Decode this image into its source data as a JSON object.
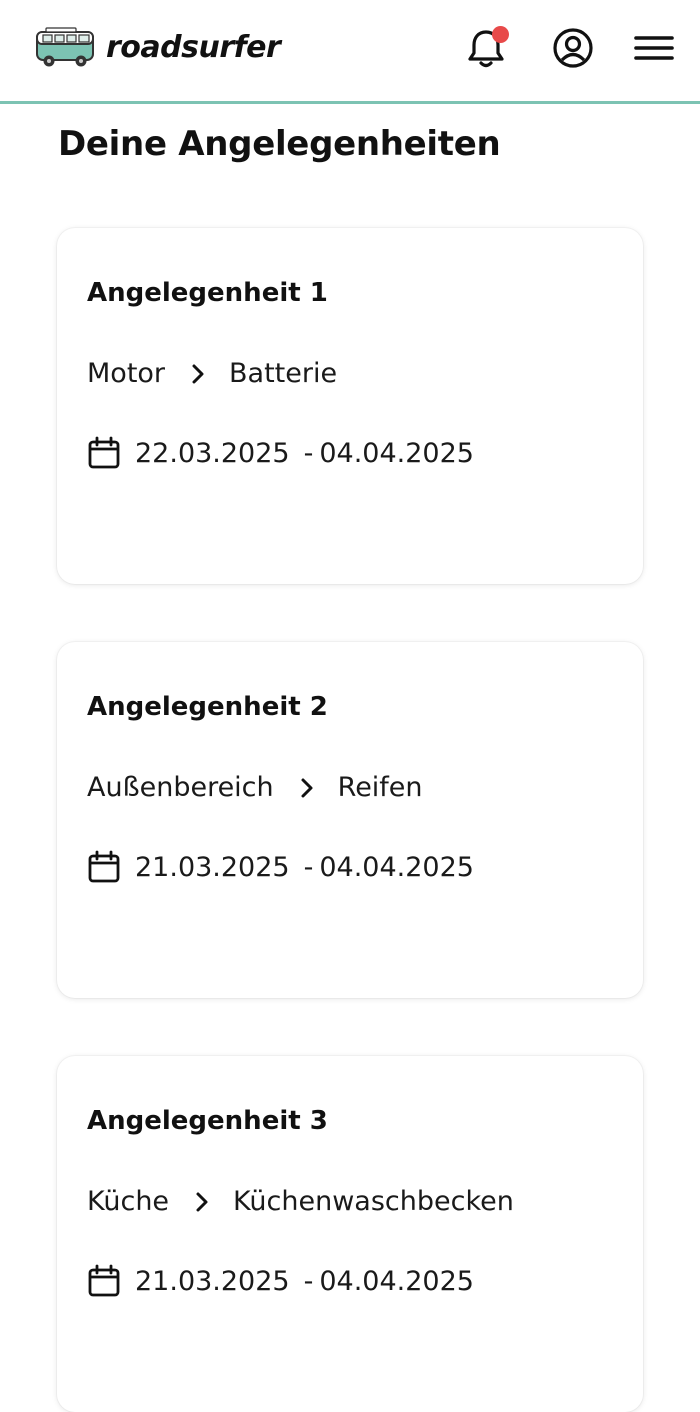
{
  "header": {
    "logo_text": "roadsurfer",
    "brand_color": "#7cc3b3",
    "notification_dot_color": "#e84a4a",
    "icons": [
      "bell-icon",
      "account-icon",
      "menu-icon"
    ]
  },
  "page": {
    "title": "Deine Angelegenheiten"
  },
  "issues": [
    {
      "title": "Angelegenheit 1",
      "category": "Motor",
      "subcategory": "Batterie",
      "start_date": "22.03.2025",
      "separator": "-",
      "end_date": "04.04.2025"
    },
    {
      "title": "Angelegenheit 2",
      "category": "Außenbereich",
      "subcategory": "Reifen",
      "start_date": "21.03.2025",
      "separator": "-",
      "end_date": "04.04.2025"
    },
    {
      "title": "Angelegenheit 3",
      "category": "Küche",
      "subcategory": "Küchenwaschbecken",
      "start_date": "21.03.2025",
      "separator": "-",
      "end_date": "04.04.2025"
    }
  ]
}
